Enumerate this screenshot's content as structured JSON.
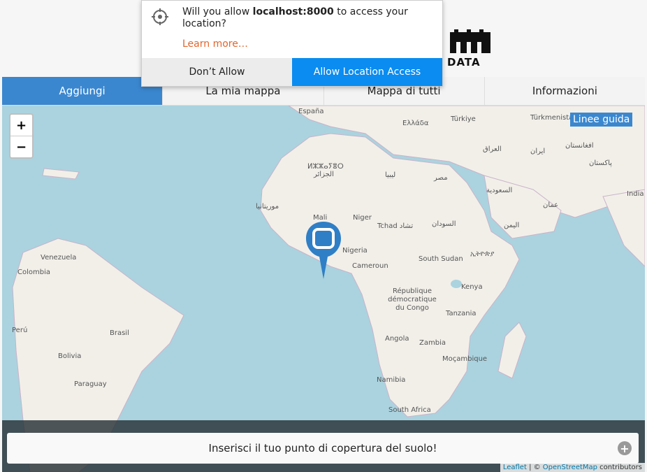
{
  "header": {
    "logo_text": "DATA"
  },
  "tabs": [
    {
      "label": "Aggiungi"
    },
    {
      "label": "La mia mappa"
    },
    {
      "label": "Mappa di tutti"
    },
    {
      "label": "Informazioni"
    }
  ],
  "map": {
    "zoom_in": "+",
    "zoom_out": "−",
    "guide_button": "Linee guida",
    "labels": [
      "España",
      "Ελλάδα",
      "Türkiye",
      "Türkmenistan",
      "العراق",
      "ایران",
      "افغانستان",
      "پاکستان",
      "India",
      "ⵍⵣⵣⴰⵢⴻⵔ",
      "الجزائر",
      "ليبيا",
      "مصر",
      "السعودية",
      "عمان",
      "موريتانيا",
      "Mali",
      "Niger",
      "Tchad تشاد",
      "السودان",
      "اليمن",
      "Nigeria",
      "Cameroun",
      "South Sudan",
      "ኢትዮጵያ",
      "Venezuela",
      "Colombia",
      "République démocratique du Congo",
      "Kenya",
      "Tanzania",
      "Perú",
      "Brasil",
      "Bolivia",
      "Paraguay",
      "Angola",
      "Zambia",
      "Moçambique",
      "Namibia",
      "South Africa"
    ]
  },
  "cta": {
    "label": "Inserisci il tuo punto di copertura del suolo!",
    "icon": "plus-circle-icon"
  },
  "attribution": {
    "leaflet": "Leaflet",
    "sep": " | © ",
    "osm": "OpenStreetMap",
    "suffix": " contributors"
  },
  "popup": {
    "msg_pre": "Will you allow ",
    "host": "localhost:8000",
    "msg_post": " to access your location?",
    "learn": "Learn more…",
    "deny": "Don’t Allow",
    "allow": "Allow Location Access",
    "icon": "location-crosshair-icon"
  },
  "colors": {
    "accent": "#3b87cf",
    "allow": "#0a8cf0",
    "water": "#aad3df",
    "land": "#f2efe9"
  }
}
